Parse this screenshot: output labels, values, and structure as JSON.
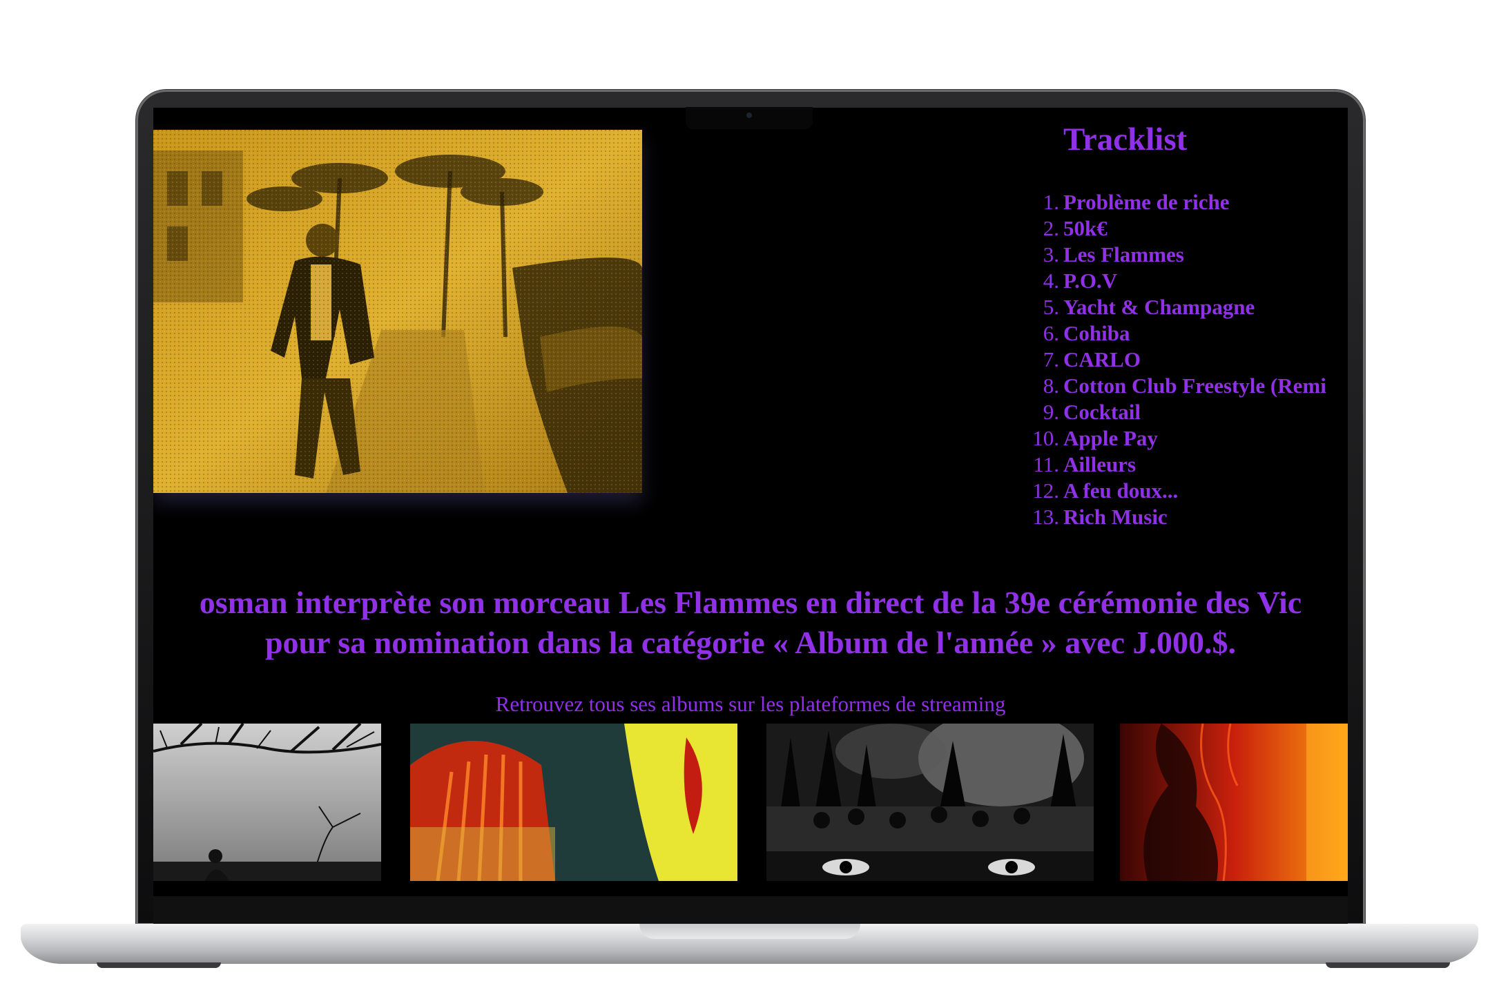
{
  "tracklist": {
    "title": "Tracklist",
    "tracks": [
      {
        "num": "1.",
        "title": "Problème de riche"
      },
      {
        "num": "2.",
        "title": "50k€"
      },
      {
        "num": "3.",
        "title": "Les Flammes"
      },
      {
        "num": "4.",
        "title": "P.O.V"
      },
      {
        "num": "5.",
        "title": "Yacht & Champagne"
      },
      {
        "num": "6.",
        "title": "Cohiba"
      },
      {
        "num": "7.",
        "title": "CARLO"
      },
      {
        "num": "8.",
        "title": "Cotton Club Freestyle (Remi"
      },
      {
        "num": "9.",
        "title": "Cocktail"
      },
      {
        "num": "10.",
        "title": "Apple Pay"
      },
      {
        "num": "11.",
        "title": "Ailleurs"
      },
      {
        "num": "12.",
        "title": "A feu doux..."
      },
      {
        "num": "13.",
        "title": "Rich Music"
      }
    ]
  },
  "headline": {
    "line1": "osman interprète son morceau Les Flammes en direct de la 39e cérémonie des Vic",
    "line2": "pour sa nomination dans la catégorie « Album de l'année » avec J.000.$."
  },
  "subtitle": "Retrouvez tous ses albums sur les plateformes de streaming",
  "colors": {
    "accent": "#9031e8",
    "background": "#000000"
  }
}
